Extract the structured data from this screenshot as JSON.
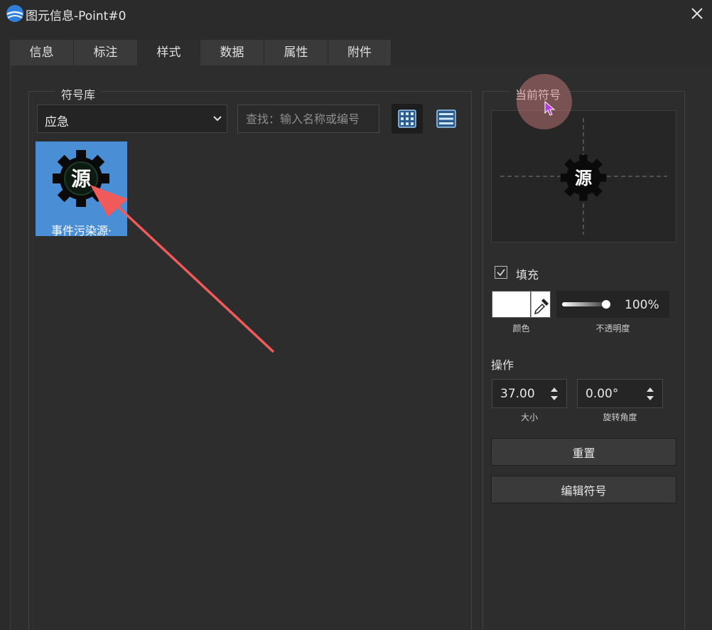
{
  "window": {
    "title": "图元信息-Point#0",
    "app_icon": "globe-logo-icon",
    "close_icon": "close-icon"
  },
  "tabs": [
    {
      "label": "信息",
      "active": false
    },
    {
      "label": "标注",
      "active": false
    },
    {
      "label": "样式",
      "active": true
    },
    {
      "label": "数据",
      "active": false
    },
    {
      "label": "属性",
      "active": false
    },
    {
      "label": "附件",
      "active": false
    }
  ],
  "library": {
    "legend": "符号库",
    "category_selected": "应急",
    "search_placeholder": "查找：输入名称或编号",
    "view_grid_icon": "grid-view-icon",
    "view_list_icon": "list-view-icon",
    "symbols": [
      {
        "name": "事件污染源·",
        "glyph": "源",
        "icon": "gear-icon",
        "selected": true
      }
    ]
  },
  "current_symbol": {
    "legend": "当前符号",
    "preview_glyph": "源",
    "preview_icon": "gear-icon"
  },
  "fill": {
    "label": "填充",
    "checked": true,
    "color": "#ffffff",
    "color_caption": "颜色",
    "eyedropper_icon": "eyedropper-icon",
    "opacity_value": "100%",
    "opacity_level": 1.0,
    "opacity_caption": "不透明度"
  },
  "operations": {
    "heading": "操作",
    "size_value": "37.00",
    "size_caption": "大小",
    "rotation_value": "0.00°",
    "rotation_caption": "旋转角度",
    "reset_label": "重置",
    "edit_label": "编辑符号"
  },
  "colors": {
    "background": "#2b2b2b",
    "selected_tile": "#4a8ed6",
    "annotation_arrow": "#f05a5a",
    "cursor": "#b43cdc"
  }
}
